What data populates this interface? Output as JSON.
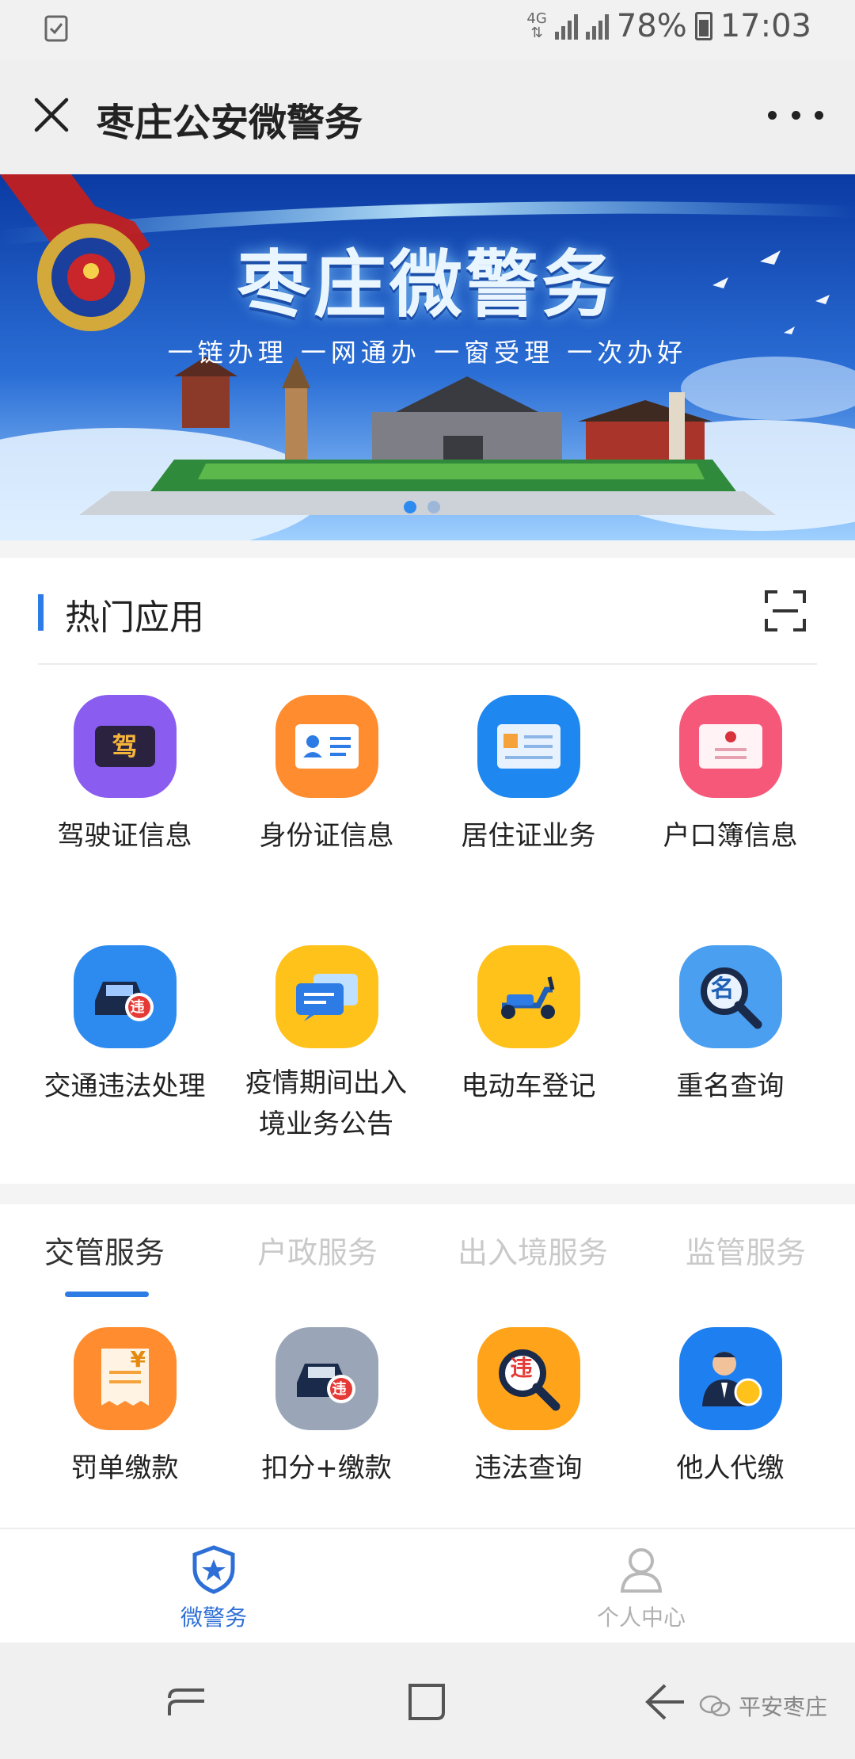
{
  "status_bar": {
    "network": "4G",
    "battery": "78%",
    "time": "17:03"
  },
  "nav": {
    "title": "枣庄公安微警务"
  },
  "banner": {
    "title": "枣庄微警务",
    "slogan": "一链办理 一网通办 一窗受理 一次办好",
    "active_slide": 1,
    "slide_count": 2
  },
  "hot_apps": {
    "title": "热门应用",
    "items": [
      {
        "label": "驾驶证信息",
        "icon": "drivers-license-icon",
        "color": "#8a5cf0",
        "glyph": "驾"
      },
      {
        "label": "身份证信息",
        "icon": "id-card-icon",
        "color": "#ff8c2e"
      },
      {
        "label": "居住证业务",
        "icon": "residence-permit-icon",
        "color": "#1e88f0"
      },
      {
        "label": "户口簿信息",
        "icon": "household-register-icon",
        "color": "#f6587a"
      },
      {
        "label": "交通违法处理",
        "icon": "traffic-violation-car-icon",
        "color": "#2d8bf0",
        "glyph": "违"
      },
      {
        "label": "疫情期间出入境业务公告",
        "icon": "chat-notice-icon",
        "color": "#ffc21a"
      },
      {
        "label": "电动车登记",
        "icon": "scooter-icon",
        "color": "#ffc21a"
      },
      {
        "label": "重名查询",
        "icon": "name-search-icon",
        "color": "#4a9ff0",
        "glyph": "名"
      }
    ]
  },
  "service_tabs": {
    "tabs": [
      "交管服务",
      "户政服务",
      "出入境服务",
      "监管服务"
    ],
    "active": 0,
    "items": [
      {
        "label": "罚单缴款",
        "icon": "ticket-payment-icon",
        "color": "#ff8c2e",
        "glyph": "¥"
      },
      {
        "label": "扣分+缴款",
        "icon": "points-payment-car-icon",
        "color": "#9aa6b8",
        "glyph": "违"
      },
      {
        "label": "违法查询",
        "icon": "violation-search-icon",
        "color": "#ffa41a",
        "glyph": "违"
      },
      {
        "label": "他人代缴",
        "icon": "proxy-payment-icon",
        "color": "#1e7ff0"
      }
    ]
  },
  "bottom_nav": {
    "items": [
      {
        "label": "微警务",
        "active": true
      },
      {
        "label": "个人中心",
        "active": false
      }
    ]
  },
  "watermark": "平安枣庄"
}
